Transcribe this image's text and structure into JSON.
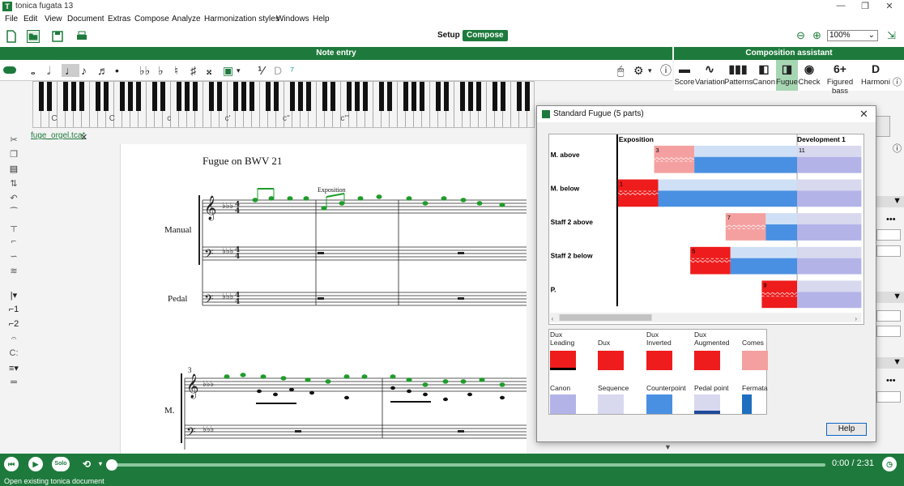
{
  "window": {
    "title": "tonica fugata 13",
    "app_icon": "tf-icon"
  },
  "menu": [
    "File",
    "Edit",
    "View",
    "Document",
    "Extras",
    "Compose",
    "Analyze",
    "Harmonization styles",
    "Windows",
    "Help"
  ],
  "toolbar": {
    "mode_setup": "Setup",
    "mode_compose": "Compose",
    "zoom": "100%"
  },
  "panels": {
    "note_entry": "Note entry",
    "composition_assistant": "Composition assistant"
  },
  "assistant_tools": [
    {
      "label": "Score",
      "icon": "score-icon",
      "glyph": "▬"
    },
    {
      "label": "Variation",
      "icon": "variation-icon",
      "glyph": "∿"
    },
    {
      "label": "Patterns",
      "icon": "patterns-icon",
      "glyph": "▮▮▮"
    },
    {
      "label": "Canon",
      "icon": "canon-icon",
      "glyph": "◧"
    },
    {
      "label": "Fugue",
      "icon": "fugue-icon",
      "glyph": "◨",
      "active": true
    },
    {
      "label": "Check",
      "icon": "check-icon",
      "glyph": "◉"
    },
    {
      "label": "Figured bass",
      "icon": "figured-bass-icon",
      "glyph": "6+"
    },
    {
      "label": "Harmoni",
      "icon": "harmonize-icon",
      "glyph": "D"
    }
  ],
  "keyboard": {
    "labels": [
      "C",
      "C",
      "c",
      "c'",
      "c''",
      "c'''"
    ]
  },
  "document": {
    "tab": "fuge_orgel.tca*"
  },
  "score": {
    "title": "Fugue on BWV 21",
    "section_label": "Exposition",
    "staff_labels": {
      "manual": "Manual",
      "pedal": "Pedal",
      "m": "M."
    },
    "measure_number": "3"
  },
  "dialog": {
    "title": "Standard Fugue (5 parts)",
    "sections": [
      "Exposition",
      "Development 1"
    ],
    "voices": [
      {
        "name": "M. above",
        "entry": "3"
      },
      {
        "name": "M. below",
        "entry": "1"
      },
      {
        "name": "Staff 2 above",
        "entry": "7"
      },
      {
        "name": "Staff 2 below",
        "entry": "5"
      },
      {
        "name": "P.",
        "entry": "9"
      }
    ],
    "dev_number": "11",
    "legend": [
      {
        "top": "Dux",
        "bottom": "Leading"
      },
      {
        "top": "",
        "bottom": "Dux"
      },
      {
        "top": "Dux",
        "bottom": "Inverted"
      },
      {
        "top": "Dux",
        "bottom": "Augmented"
      },
      {
        "top": "",
        "bottom": "Comes"
      },
      {
        "top": "",
        "bottom": "Canon"
      },
      {
        "top": "",
        "bottom": "Sequence"
      },
      {
        "top": "",
        "bottom": "Counterpoint"
      },
      {
        "top": "",
        "bottom": "Pedal point"
      },
      {
        "top": "",
        "bottom": "Fermata"
      }
    ],
    "help": "Help"
  },
  "playback": {
    "solo": "Solo",
    "time": "0:00 / 2:31"
  },
  "status": "Open existing tonica document",
  "colors": {
    "green": "#1e7a3c",
    "dux_red": "#ee1c1c",
    "dux_light": "#f4a0a0",
    "counterpoint_blue": "#4a90e2",
    "canon_lavender": "#b3b3e8"
  }
}
